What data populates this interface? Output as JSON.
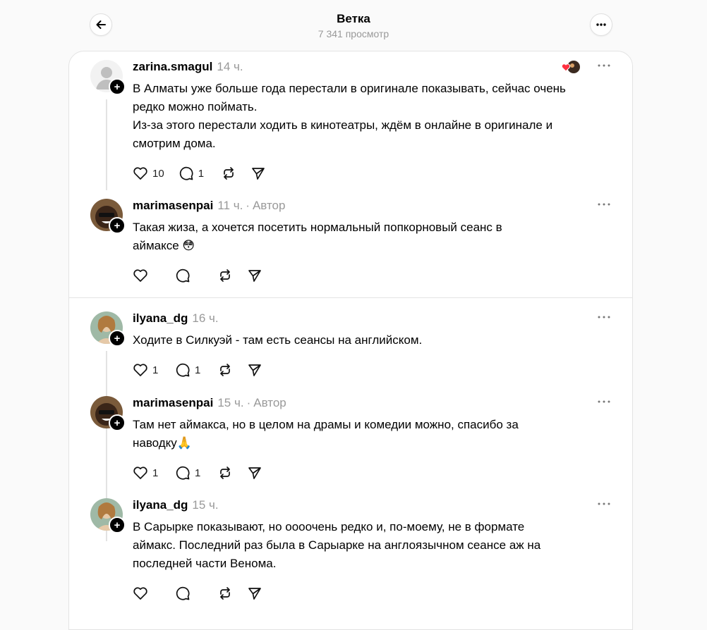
{
  "header": {
    "title": "Ветка",
    "views": "7 341 просмотр"
  },
  "posts": [
    {
      "username": "zarina.smagul",
      "time": "14 ч.",
      "author_label": "",
      "lines": [
        "В Алматы уже больше года перестали в оригинале показывать, сейчас очень",
        "редко можно поймать.",
        "Из-за этого перестали ходить в кинотеатры, ждём в онлайне в оригинале и",
        "смотрим дома."
      ],
      "likes": "10",
      "replies": "1"
    },
    {
      "username": "marimasenpai",
      "time": "11 ч.",
      "author_label": "Автор",
      "lines": [
        "Такая жиза, а хочется посетить нормальный попкорновый сеанс в",
        "аймаксе 😳"
      ],
      "likes": "",
      "replies": ""
    },
    {
      "username": "ilyana_dg",
      "time": "16 ч.",
      "author_label": "",
      "lines": [
        "Ходите в Силкуэй - там есть сеансы на английском."
      ],
      "likes": "1",
      "replies": "1"
    },
    {
      "username": "marimasenpai",
      "time": "15 ч.",
      "author_label": "Автор",
      "lines": [
        "Там нет аймакса, но в целом на драмы и комедии можно, спасибо за",
        "наводку🙏"
      ],
      "likes": "1",
      "replies": "1"
    },
    {
      "username": "ilyana_dg",
      "time": "15 ч.",
      "author_label": "",
      "lines": [
        "В Сарырке показывают, но оооочень редко и, по-моему, не в формате",
        "аймакс. Последний раз была в Сарыарке на англоязычном сеансе аж на",
        "последней части Венома."
      ],
      "likes": "",
      "replies": ""
    }
  ],
  "icons": {
    "back": "arrow-left-icon",
    "more": "more-horizontal-icon",
    "like": "heart-icon",
    "reply": "comment-icon",
    "repost": "repost-icon",
    "share": "send-icon",
    "follow": "plus-icon"
  },
  "colors": {
    "muted": "#999999",
    "border": "#e3e3e3",
    "reaction_heart": "#ff3040"
  }
}
